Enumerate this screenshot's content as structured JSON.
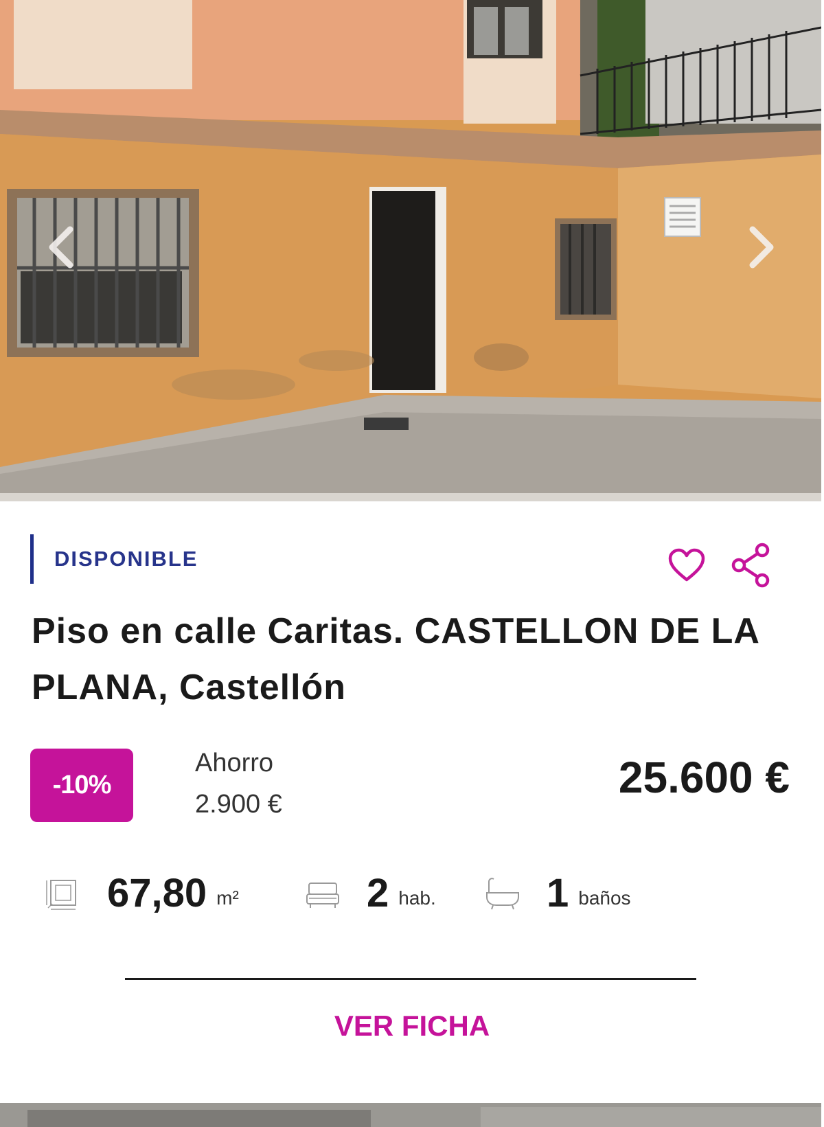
{
  "listing": {
    "status": "DISPONIBLE",
    "title": "Piso en calle Caritas. CASTELLON DE LA PLANA, Castellón",
    "discount_badge": "-10%",
    "savings_label": "Ahorro",
    "savings_value": "2.900 €",
    "price": "25.600 €",
    "features": {
      "area": {
        "value": "67,80",
        "unit": "m²",
        "icon": "floorplan-icon"
      },
      "bedrooms": {
        "value": "2",
        "unit": "hab.",
        "icon": "bed-icon"
      },
      "bathrooms": {
        "value": "1",
        "unit": "baños",
        "icon": "bathtub-icon"
      }
    },
    "cta_label": "VER FICHA"
  },
  "colors": {
    "accent": "#c5139a",
    "status": "#27348b",
    "text": "#1a1a1a"
  },
  "icons": {
    "photo_prev": "chevron-left-icon",
    "photo_next": "chevron-right-icon",
    "favorite": "heart-icon",
    "share": "share-icon"
  }
}
